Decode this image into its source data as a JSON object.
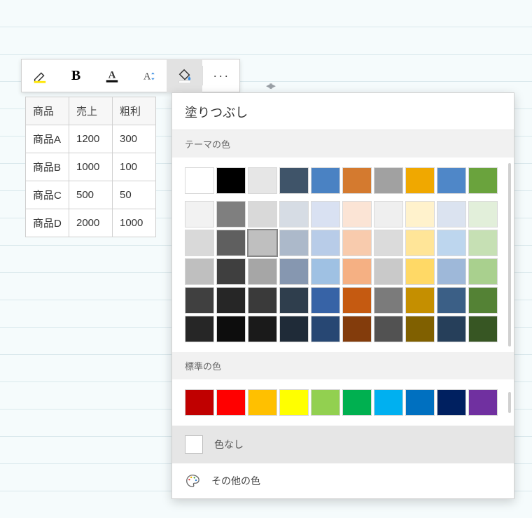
{
  "toolbar": {
    "highlight_color": "#ffe600",
    "font_color_bar": "#111111",
    "fill_color_bar": "#ffffff"
  },
  "table": {
    "headers": [
      "商品",
      "売上",
      "粗利"
    ],
    "rows": [
      [
        "商品A",
        "1200",
        "300"
      ],
      [
        "商品B",
        "1000",
        "100"
      ],
      [
        "商品C",
        "500",
        "50"
      ],
      [
        "商品D",
        "2000",
        "1000"
      ]
    ]
  },
  "color_panel": {
    "title": "塗りつぶし",
    "theme_label": "テーマの色",
    "standard_label": "標準の色",
    "no_fill_label": "色なし",
    "more_colors_label": "その他の色",
    "theme_top_row": [
      "#ffffff",
      "#000000",
      "#e6e6e6",
      "#3f5469",
      "#4a82c3",
      "#d47a2f",
      "#a1a1a1",
      "#f0a800",
      "#4f87c8",
      "#6aa33d"
    ],
    "theme_grid": [
      [
        "#f2f2f2",
        "#7f7f7f",
        "#d9d9d9",
        "#d6dce4",
        "#d9e1f2",
        "#fbe4d5",
        "#efefef",
        "#fff2cc",
        "#dbe3f0",
        "#e2efda"
      ],
      [
        "#d9d9d9",
        "#5f5f5f",
        "#bfbfbf",
        "#acb9ca",
        "#b8cce8",
        "#f8cbad",
        "#dbdbdb",
        "#ffe598",
        "#bdd6ee",
        "#c6e0b4"
      ],
      [
        "#bfbfbf",
        "#3f3f3f",
        "#a6a6a6",
        "#8697b0",
        "#9fc1e3",
        "#f5b083",
        "#c9c9c9",
        "#ffd966",
        "#9eb8d9",
        "#a9d08e"
      ],
      [
        "#404040",
        "#262626",
        "#3a3a3a",
        "#2f3e4d",
        "#3763a6",
        "#c55a11",
        "#7b7b7b",
        "#c58f00",
        "#3b5f86",
        "#548235"
      ],
      [
        "#262626",
        "#0d0d0d",
        "#1a1a1a",
        "#1f2b38",
        "#274773",
        "#833c0c",
        "#525252",
        "#806000",
        "#263f5a",
        "#375623"
      ]
    ],
    "selected": {
      "grid": "theme_grid",
      "row": 1,
      "col": 2
    },
    "standard_row": [
      "#c00000",
      "#ff0000",
      "#ffc000",
      "#ffff00",
      "#92d050",
      "#00b050",
      "#00b0f0",
      "#0070c0",
      "#002060",
      "#7030a0"
    ]
  }
}
